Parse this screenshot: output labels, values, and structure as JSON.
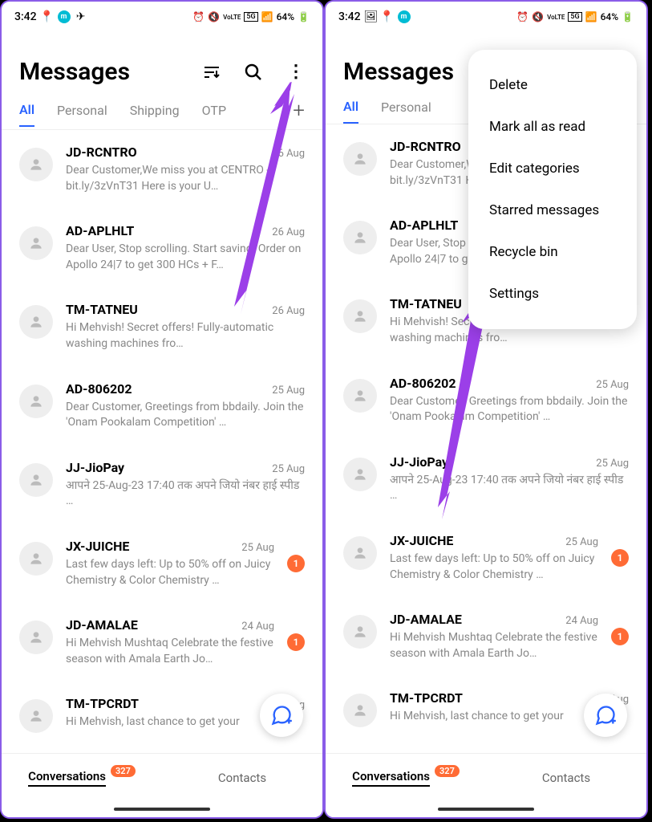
{
  "status": {
    "time": "3:42",
    "battery": "64%",
    "net": "5G",
    "lte": "VoLTE"
  },
  "header": {
    "title": "Messages"
  },
  "tabs": [
    "All",
    "Personal",
    "Shipping",
    "OTP"
  ],
  "messages": [
    {
      "sender": "JD-RCNTRO",
      "date": "26 Aug",
      "preview": "Dear Customer,We miss you at CENTRO - bit.ly/3zVnT31 Here is your U…",
      "badge": null
    },
    {
      "sender": "AD-APLHLT",
      "date": "26 Aug",
      "preview": "Dear User,  Stop scrolling. Start saving. Order on Apollo 24|7 to get 300 HCs + F…",
      "badge": null
    },
    {
      "sender": "TM-TATNEU",
      "date": "26 Aug",
      "preview": "Hi Mehvish! Secret offers! Fully-automatic washing machines fro…",
      "badge": null
    },
    {
      "sender": "AD-806202",
      "date": "25 Aug",
      "preview": "Dear Customer, Greetings from bbdaily. Join the 'Onam Pookalam Competition' …",
      "badge": null
    },
    {
      "sender": "JJ-JioPay",
      "date": "25 Aug",
      "preview": "आपने 25-Aug-23 17:40 तक अपने जियो नंबर                                     हाई स्पीड …",
      "badge": null
    },
    {
      "sender": "JX-JUICHE",
      "date": "25 Aug",
      "preview": "Last few days left: Up to 50% off on Juicy Chemistry & Color Chemistry …",
      "badge": "1"
    },
    {
      "sender": "JD-AMALAE",
      "date": "24 Aug",
      "preview": "Hi Mehvish Mushtaq Celebrate the festive season with Amala Earth Jo…",
      "badge": "1"
    },
    {
      "sender": "TM-TPCRDT",
      "date": "24 Aug",
      "preview": "Hi Mehvish, last chance to get your",
      "badge": null
    }
  ],
  "nav": {
    "conversations": "Conversations",
    "contacts": "Contacts",
    "count": "327"
  },
  "menu": [
    "Delete",
    "Mark all as read",
    "Edit categories",
    "Starred messages",
    "Recycle bin",
    "Settings"
  ]
}
